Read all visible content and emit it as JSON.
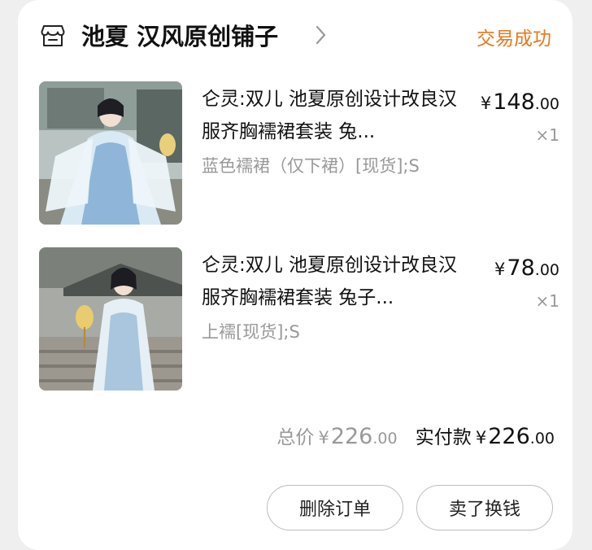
{
  "shop": {
    "name": "池夏 汉风原创铺子",
    "icon": "shop-icon"
  },
  "order_status": "交易成功",
  "items": [
    {
      "title": "仑灵:双儿 池夏原创设计改良汉服齐胸襦裙套装 兔...",
      "sku": "蓝色襦裙（仅下裙）[现货];S",
      "price_symbol": "¥",
      "price_int": "148",
      "price_dec": ".00",
      "qty": "×1"
    },
    {
      "title": "仑灵:双儿 池夏原创设计改良汉服齐胸襦裙套装 兔子...",
      "sku": "上襦[现货];S",
      "price_symbol": "¥",
      "price_int": "78",
      "price_dec": ".00",
      "qty": "×1"
    }
  ],
  "totals": {
    "total_label": "总价",
    "total_symbol": "¥",
    "total_int": "226",
    "total_dec": ".00",
    "paid_label": "实付款",
    "paid_symbol": "¥",
    "paid_int": "226",
    "paid_dec": ".00"
  },
  "actions": {
    "delete_label": "删除订单",
    "sell_label": "卖了换钱"
  },
  "colors": {
    "status_accent": "#e8781b",
    "muted_text": "#999999",
    "primary_text": "#111111"
  }
}
